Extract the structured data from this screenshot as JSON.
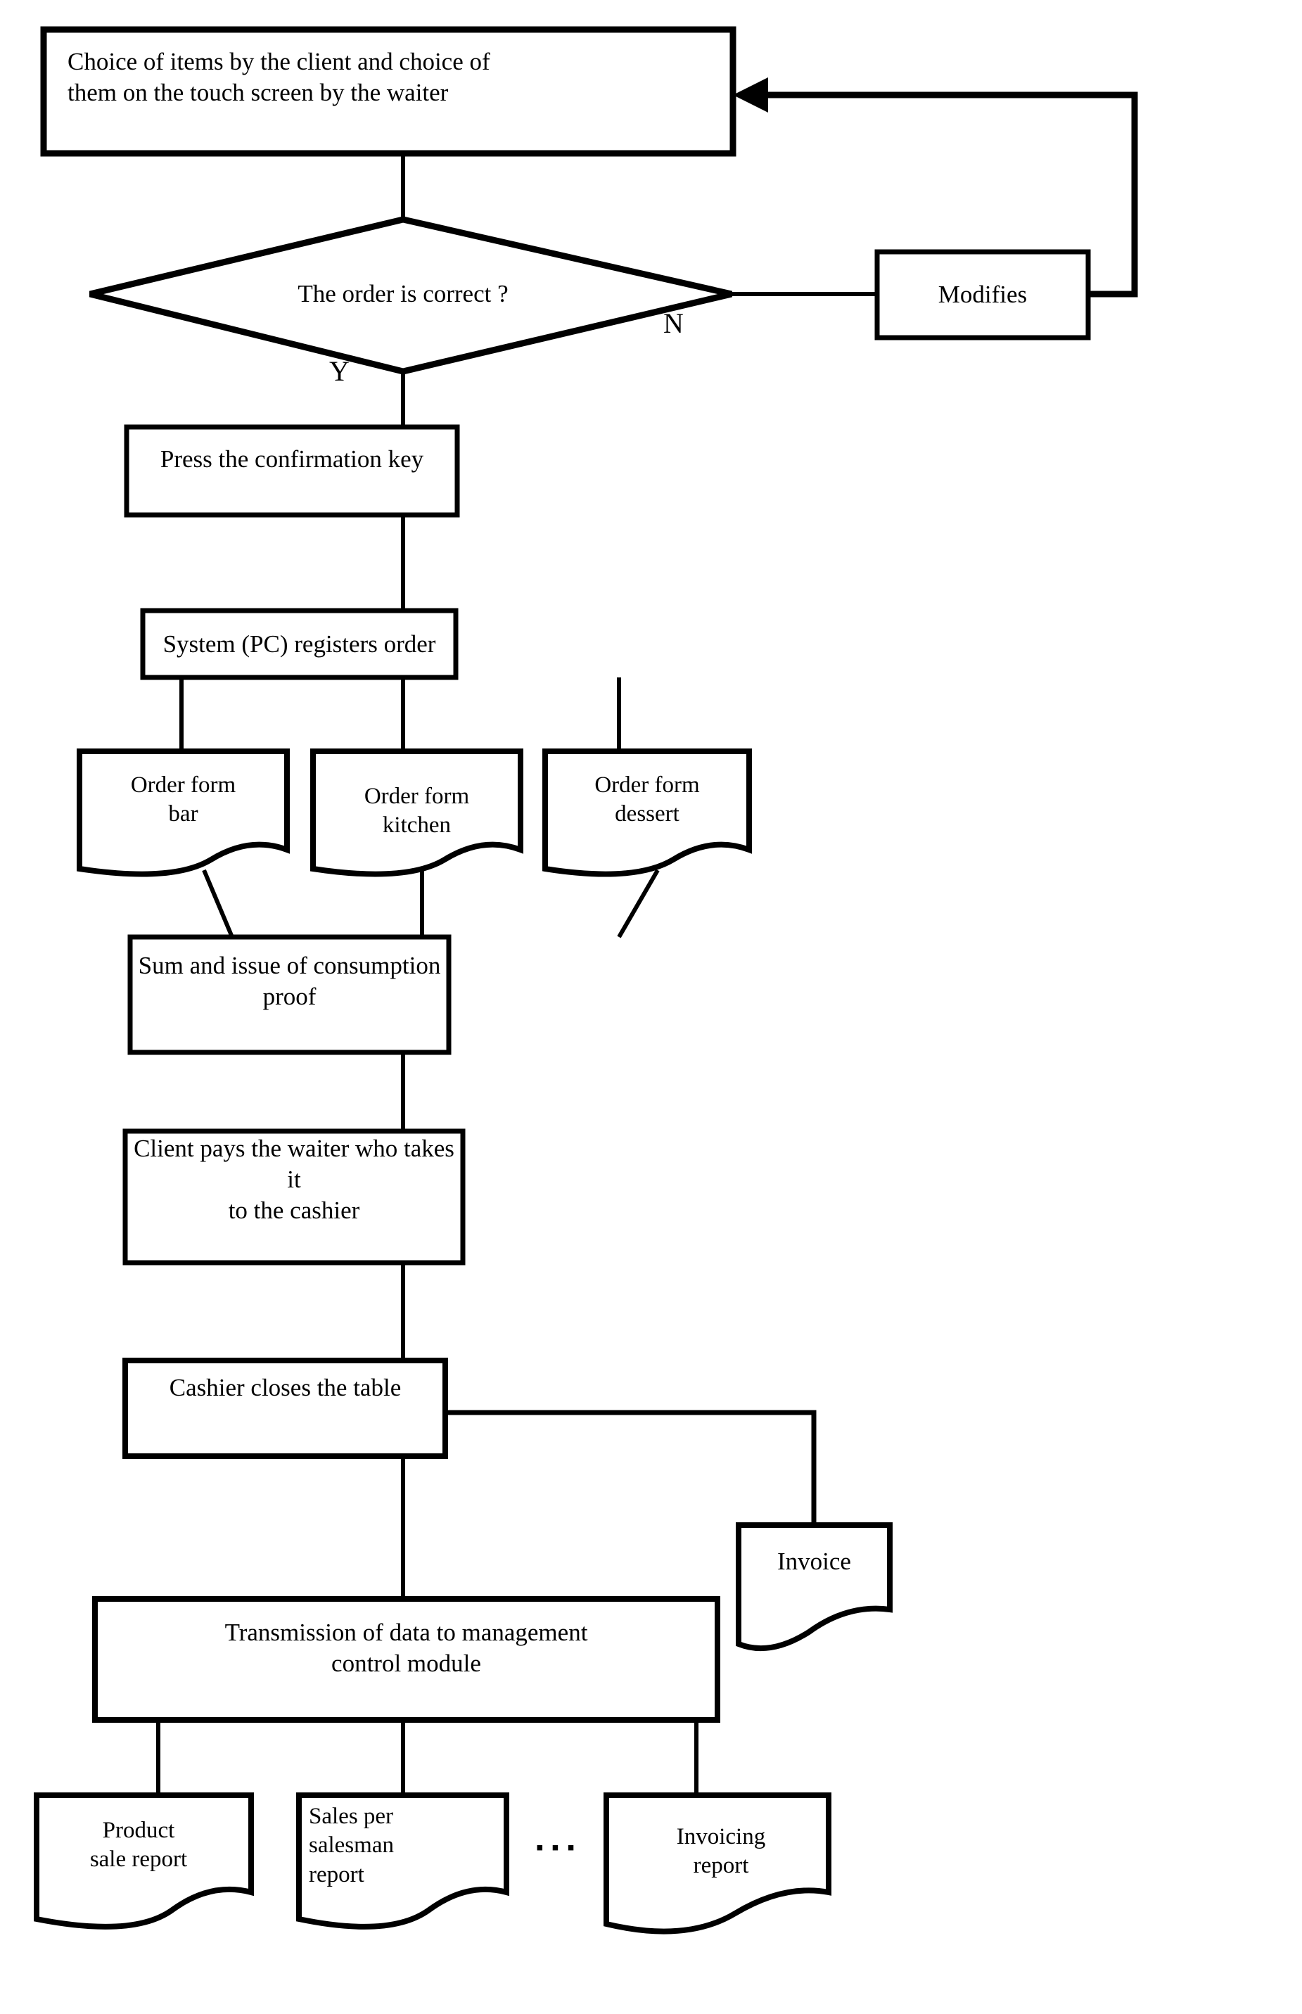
{
  "diagram": {
    "type": "flowchart",
    "title": "Restaurant order and billing process flowchart",
    "orientation": "top-to-bottom",
    "nodes": [
      {
        "id": "choice",
        "shape": "process",
        "label": "Choice of items by the client and choice of\nthem on the touch screen by the waiter"
      },
      {
        "id": "decision",
        "shape": "decision",
        "label": "The order is correct ?"
      },
      {
        "id": "modifies",
        "shape": "process",
        "label": "Modifies"
      },
      {
        "id": "confirm",
        "shape": "process",
        "label": "Press the confirmation key"
      },
      {
        "id": "register",
        "shape": "process",
        "label": "System (PC) registers order"
      },
      {
        "id": "form-bar",
        "shape": "document",
        "label": "Order form\nbar"
      },
      {
        "id": "form-kitchen",
        "shape": "document",
        "label": "Order form\nkitchen"
      },
      {
        "id": "form-dessert",
        "shape": "document",
        "label": "Order form\ndessert"
      },
      {
        "id": "sum-issue",
        "shape": "process",
        "label": "Sum and issue of consumption\nproof"
      },
      {
        "id": "client-pays",
        "shape": "process",
        "label": "Client pays the waiter who takes it\nto the cashier"
      },
      {
        "id": "cashier-closes",
        "shape": "process",
        "label": "Cashier closes the table"
      },
      {
        "id": "invoice",
        "shape": "document",
        "label": "Invoice"
      },
      {
        "id": "transmission",
        "shape": "process",
        "label": "Transmission of data to management\ncontrol module"
      },
      {
        "id": "product-report",
        "shape": "document",
        "label": "Product\nsale report"
      },
      {
        "id": "salesman-report",
        "shape": "document",
        "label": "Sales per\nsalesman\nreport"
      },
      {
        "id": "invoicing-report",
        "shape": "document",
        "label": "Invoicing\nreport"
      }
    ],
    "branch_labels": {
      "yes": "Y",
      "no": "N"
    },
    "ellipsis": "▪ ▪ ▪",
    "edges": [
      {
        "from": "choice",
        "to": "decision",
        "label": ""
      },
      {
        "from": "decision",
        "to": "modifies",
        "label": "N"
      },
      {
        "from": "modifies",
        "to": "choice",
        "label": "",
        "arrow": true
      },
      {
        "from": "decision",
        "to": "confirm",
        "label": "Y"
      },
      {
        "from": "confirm",
        "to": "register",
        "label": ""
      },
      {
        "from": "register",
        "to": "form-bar",
        "label": ""
      },
      {
        "from": "register",
        "to": "form-kitchen",
        "label": ""
      },
      {
        "from": "register",
        "to": "form-dessert",
        "label": ""
      },
      {
        "from": "form-bar",
        "to": "sum-issue",
        "label": ""
      },
      {
        "from": "form-kitchen",
        "to": "sum-issue",
        "label": ""
      },
      {
        "from": "form-dessert",
        "to": "sum-issue",
        "label": ""
      },
      {
        "from": "sum-issue",
        "to": "client-pays",
        "label": ""
      },
      {
        "from": "client-pays",
        "to": "cashier-closes",
        "label": ""
      },
      {
        "from": "cashier-closes",
        "to": "invoice",
        "label": ""
      },
      {
        "from": "cashier-closes",
        "to": "transmission",
        "label": ""
      },
      {
        "from": "transmission",
        "to": "product-report",
        "label": ""
      },
      {
        "from": "transmission",
        "to": "salesman-report",
        "label": ""
      },
      {
        "from": "transmission",
        "to": "invoicing-report",
        "label": ""
      }
    ],
    "colors": {
      "stroke": "#000000",
      "fill": "#ffffff",
      "text": "#000000"
    }
  }
}
